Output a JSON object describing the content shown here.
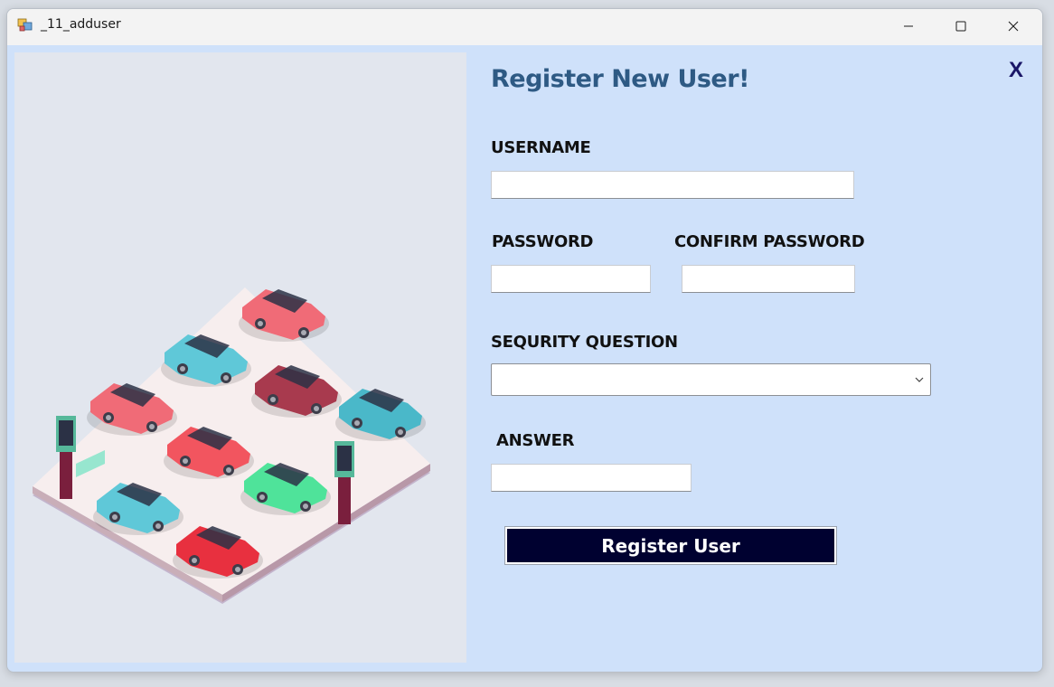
{
  "window": {
    "title": "_11_adduser"
  },
  "form": {
    "heading": "Register New User!",
    "close_label": "X",
    "username_label": "USERNAME",
    "username_value": "",
    "password_label": "PASSWORD",
    "password_value": "",
    "confirm_password_label": "CONFIRM PASSWORD",
    "confirm_password_value": "",
    "security_question_label": "SEQURITY QUESTION",
    "security_question_selected": "",
    "answer_label": "ANSWER",
    "answer_value": "",
    "register_button_label": "Register User"
  },
  "icons": [
    "app-icon",
    "minimize-icon",
    "maximize-icon",
    "close-icon",
    "chevron-down-icon"
  ],
  "colors": {
    "background": "#cfe1fa",
    "heading": "#2e5a84",
    "button": "#000130",
    "close_x": "#1a1667"
  }
}
